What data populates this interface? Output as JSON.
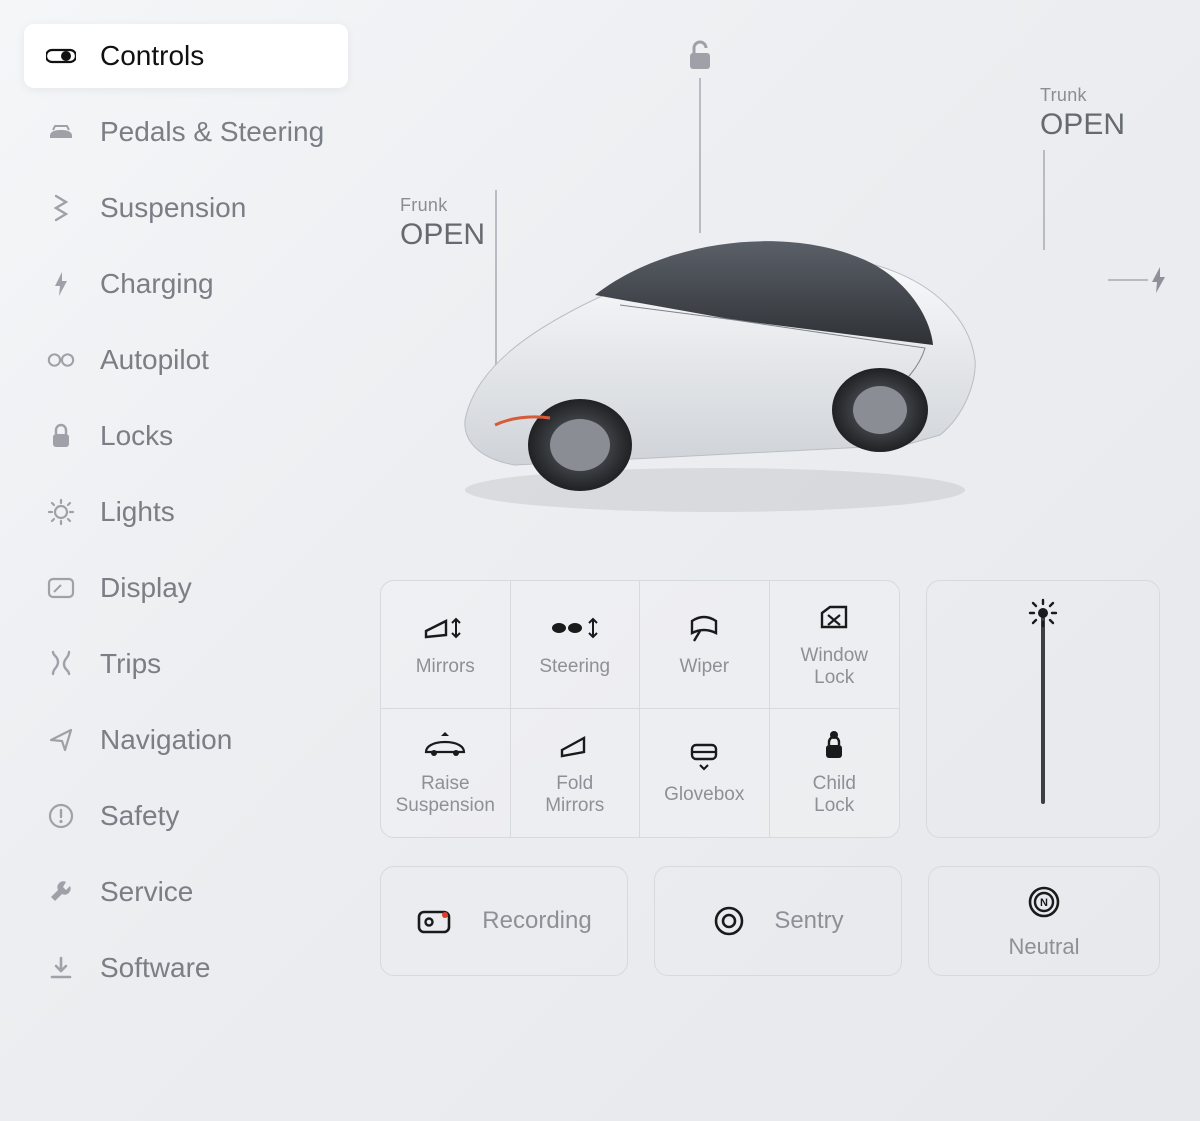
{
  "sidebar": {
    "items": [
      {
        "label": "Controls",
        "icon": "slider-icon",
        "active": true
      },
      {
        "label": "Pedals & Steering",
        "icon": "car-icon"
      },
      {
        "label": "Suspension",
        "icon": "shock-icon"
      },
      {
        "label": "Charging",
        "icon": "bolt-icon"
      },
      {
        "label": "Autopilot",
        "icon": "steering-hands-icon"
      },
      {
        "label": "Locks",
        "icon": "lock-icon"
      },
      {
        "label": "Lights",
        "icon": "bulb-icon"
      },
      {
        "label": "Display",
        "icon": "tablet-icon"
      },
      {
        "label": "Trips",
        "icon": "route-icon"
      },
      {
        "label": "Navigation",
        "icon": "nav-arrow-icon"
      },
      {
        "label": "Safety",
        "icon": "alert-circle-icon"
      },
      {
        "label": "Service",
        "icon": "wrench-icon"
      },
      {
        "label": "Software",
        "icon": "download-icon"
      }
    ]
  },
  "car": {
    "frunk": {
      "label": "Frunk",
      "action": "OPEN"
    },
    "trunk": {
      "label": "Trunk",
      "action": "OPEN"
    },
    "lock_state": "unlocked",
    "charge_port": "closed"
  },
  "quick": [
    {
      "label": "Mirrors",
      "icon": "mirror-adjust-icon"
    },
    {
      "label": "Steering",
      "icon": "steering-adjust-icon"
    },
    {
      "label": "Wiper",
      "icon": "wiper-icon"
    },
    {
      "label": "Window\nLock",
      "icon": "window-lock-icon"
    },
    {
      "label": "Raise\nSuspension",
      "icon": "raise-suspension-icon"
    },
    {
      "label": "Fold\nMirrors",
      "icon": "fold-mirror-icon"
    },
    {
      "label": "Glovebox",
      "icon": "glovebox-icon"
    },
    {
      "label": "Child\nLock",
      "icon": "child-lock-icon"
    }
  ],
  "brightness": {
    "value": 100
  },
  "bottom": {
    "recording_label": "Recording",
    "sentry_label": "Sentry",
    "neutral_label": "Neutral"
  }
}
